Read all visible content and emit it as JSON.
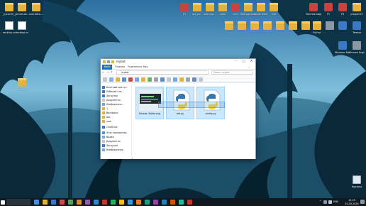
{
  "desktop": {
    "icons_left": [
      {
        "label": "_pycache__",
        "glyph": "folder-icon"
      },
      {
        "label": "secure-ab...",
        "glyph": "folder-icon"
      },
      {
        "label": "user-data-...",
        "glyph": "folder-icon"
      },
      {
        "label": "desktop.ini",
        "glyph": "document-icon"
      },
      {
        "label": "desktop.ini",
        "glyph": "document-icon"
      },
      {
        "label": "mybot",
        "glyph": "folder-icon"
      }
    ],
    "icons_top_right": [
      {
        "label": "IO",
        "glyph": "app-icon"
      },
      {
        "label": "ssd_co...",
        "glyph": "folder-icon"
      },
      {
        "label": "ssd-cryp...",
        "glyph": "folder-icon"
      },
      {
        "label": "voice",
        "glyph": "folder-icon"
      },
      {
        "label": "cmd",
        "glyph": "app-icon"
      },
      {
        "label": "Мой документ",
        "glyph": "folder-icon"
      },
      {
        "label": "audio Hotel",
        "glyph": "folder-icon"
      },
      {
        "label": "hub",
        "glyph": "folder-icon"
      },
      {
        "label": "Монтаж видео",
        "glyph": "app-icon"
      },
      {
        "label": "F5",
        "glyph": "app-icon"
      },
      {
        "label": "F6",
        "glyph": "app-icon"
      },
      {
        "label": "programm",
        "glyph": "folder-icon"
      }
    ],
    "icons_second_row": [
      {
        "label": "",
        "glyph": "folder-icon"
      },
      {
        "label": "",
        "glyph": "folder-icon"
      },
      {
        "label": "",
        "glyph": "folder-icon"
      },
      {
        "label": "",
        "glyph": "folder-icon"
      },
      {
        "label": "",
        "glyph": "folder-icon"
      },
      {
        "label": "",
        "glyph": "folder-icon"
      },
      {
        "label": "",
        "glyph": "folder-icon"
      },
      {
        "label": "Python",
        "glyph": "folder-icon"
      },
      {
        "label": "",
        "glyph": "app-icon"
      },
      {
        "label": "",
        "glyph": "app-icon"
      },
      {
        "label": "Telebot",
        "glyph": "app-icon"
      }
    ],
    "icons_right_column": [
      {
        "label": "Windows Media P.",
        "glyph": "app-icon"
      },
      {
        "label": "Chrome Engine",
        "glyph": "app-icon"
      },
      {
        "label": "Корзина",
        "glyph": "recycle-bin-icon"
      }
    ]
  },
  "explorer": {
    "title": "mybot",
    "tabs": [
      "Файл",
      "Главная",
      "Поделиться",
      "Вид"
    ],
    "address": "mybot",
    "search_placeholder": "Поиск: mybot",
    "nav_items": [
      {
        "label": "Быстрый доступ",
        "icon": "star-icon"
      },
      {
        "label": "Рабочий сто...",
        "icon": "desktop-icon"
      },
      {
        "label": "Загрузки",
        "icon": "download-icon"
      },
      {
        "label": "Документы",
        "icon": "document-icon"
      },
      {
        "label": "Изображени...",
        "icon": "image-icon"
      },
      {
        "label": "1",
        "icon": "folder-icon"
      },
      {
        "label": "Backbone",
        "icon": "folder-icon"
      },
      {
        "label": "bot",
        "icon": "folder-icon"
      },
      {
        "label": "new",
        "icon": "folder-icon"
      },
      {
        "label": "OneDrive",
        "icon": "cloud-icon"
      },
      {
        "label": "Этот компьютер",
        "icon": "computer-icon"
      },
      {
        "label": "Видео",
        "icon": "video-icon"
      },
      {
        "label": "Документы",
        "icon": "document-icon"
      },
      {
        "label": "Загрузки",
        "icon": "download-icon"
      },
      {
        "label": "Изображения",
        "icon": "image-icon"
      }
    ],
    "files": [
      {
        "name": "Безым. fiolde.png",
        "type": "image-thumbnail"
      },
      {
        "name": "bot.py",
        "type": "python-file-icon"
      },
      {
        "name": "config.py",
        "type": "python-file-icon"
      }
    ]
  },
  "taskbar": {
    "language": "ENG",
    "time": "12:29",
    "date": "20.05.2020"
  },
  "colors": {
    "accent": "#1f6fc5",
    "selection": "#cce8ff",
    "folder": "#e5b33d",
    "taskbar": "#101820"
  }
}
